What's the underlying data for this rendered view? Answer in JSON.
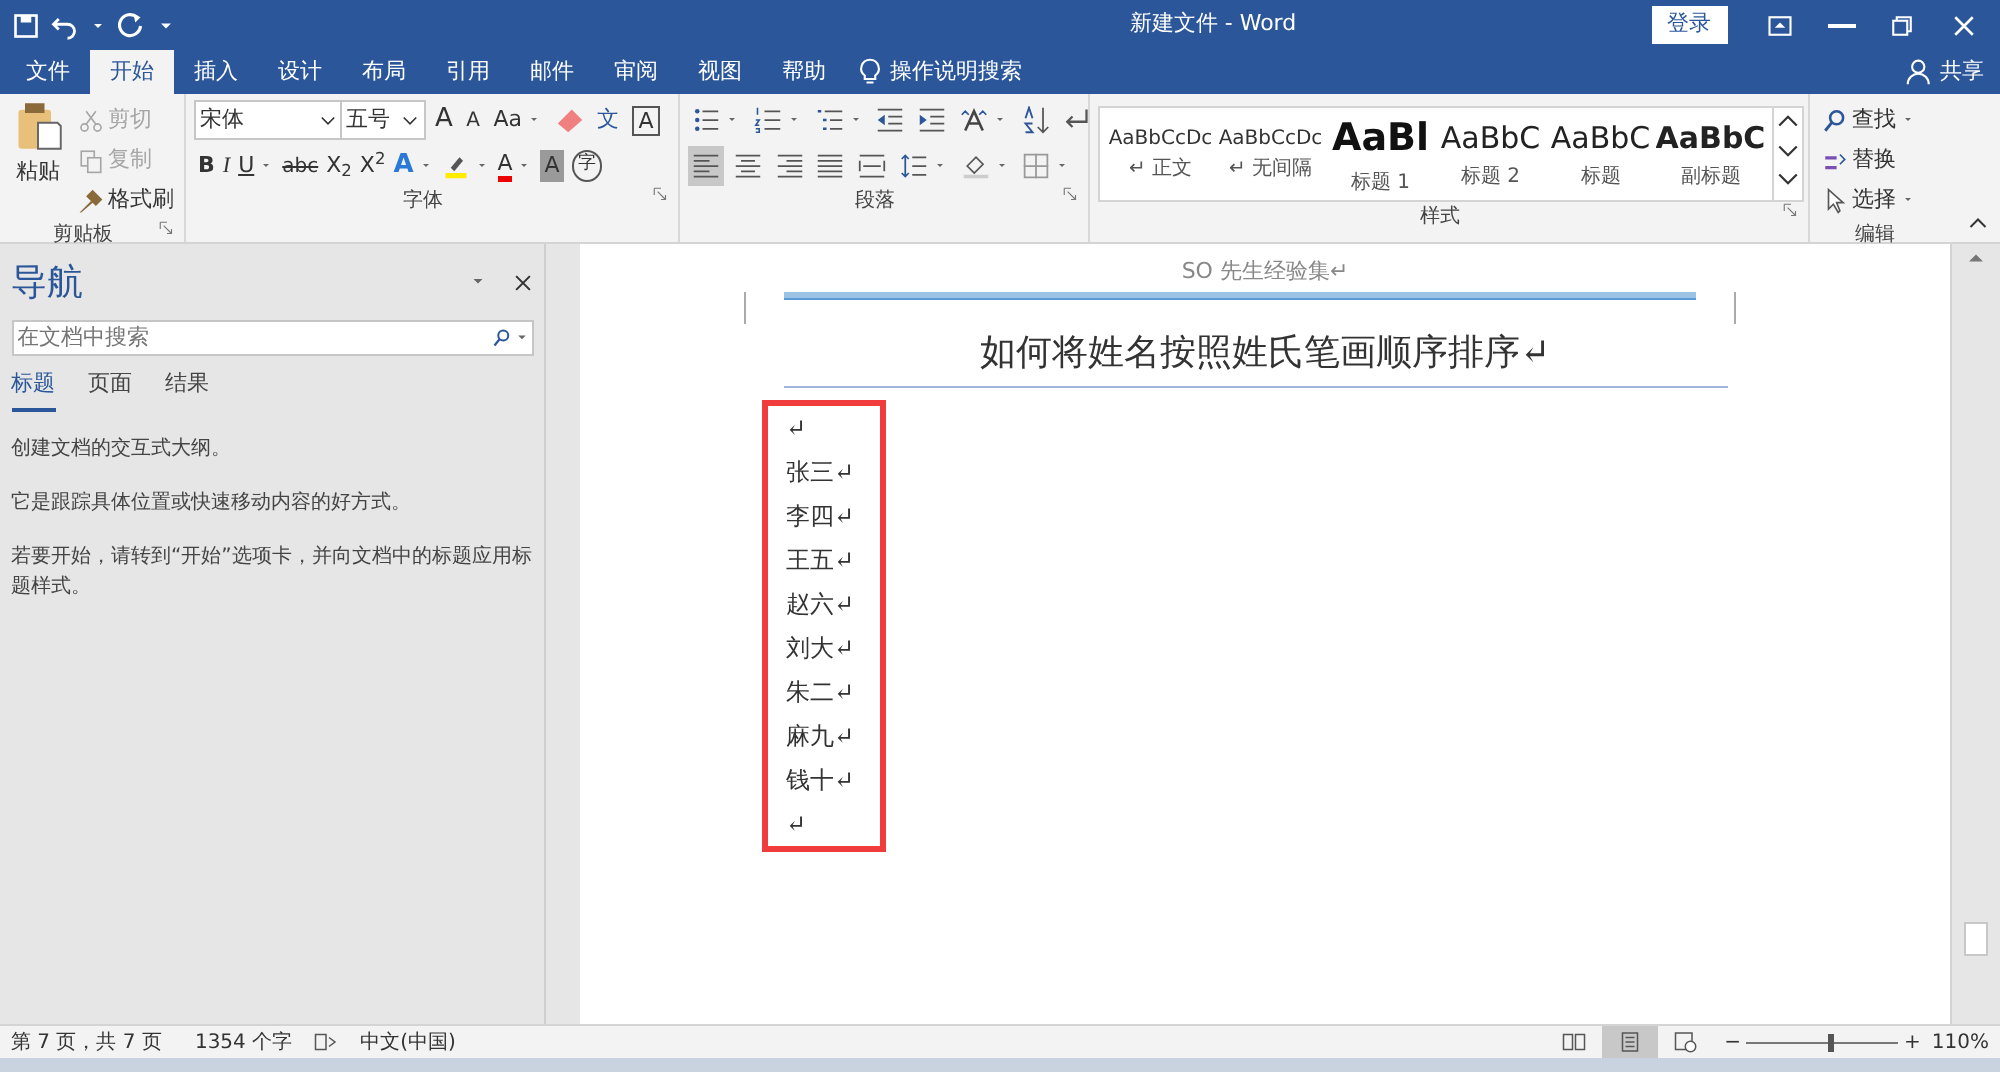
{
  "window": {
    "title": "新建文件 - Word",
    "login": "登录"
  },
  "tabs": [
    {
      "label": "文件",
      "selected": false
    },
    {
      "label": "开始",
      "selected": true
    },
    {
      "label": "插入",
      "selected": false
    },
    {
      "label": "设计",
      "selected": false
    },
    {
      "label": "布局",
      "selected": false
    },
    {
      "label": "引用",
      "selected": false
    },
    {
      "label": "邮件",
      "selected": false
    },
    {
      "label": "审阅",
      "selected": false
    },
    {
      "label": "视图",
      "selected": false
    },
    {
      "label": "帮助",
      "selected": false
    }
  ],
  "tell_me": "操作说明搜索",
  "share": "共享",
  "clipboard": {
    "paste": "粘贴",
    "cut": {
      "label": "剪切",
      "disabled": true
    },
    "copy": {
      "label": "复制",
      "disabled": true
    },
    "format_painter": {
      "label": "格式刷",
      "disabled": false
    },
    "label": "剪贴板"
  },
  "font": {
    "name": "宋体",
    "size": "五号",
    "grow": "A",
    "shrink": "A",
    "case": "Aa",
    "phonetic": "文",
    "char_border": "A",
    "bold": "B",
    "italic": "I",
    "underline": "U",
    "strike": "abc",
    "subscript": "X$_{2}$",
    "superscript": "X$^{2}$",
    "effects": "A",
    "font_color": "A",
    "char_shading": "A",
    "enclose": "字",
    "label": "字体"
  },
  "paragraph": {
    "alignments": [
      {
        "kind": "left",
        "selected": true
      },
      {
        "kind": "center",
        "selected": false
      },
      {
        "kind": "right",
        "selected": false
      },
      {
        "kind": "justify",
        "selected": false
      },
      {
        "kind": "distributed",
        "selected": false
      }
    ],
    "label": "段落"
  },
  "styles": {
    "items": [
      {
        "preview": "AaBbCcDc",
        "label": "↵ 正文",
        "kind": "normal"
      },
      {
        "preview": "AaBbCcDc",
        "label": "↵ 无间隔",
        "kind": "normal"
      },
      {
        "preview": "AaBl",
        "label": "标题 1",
        "kind": "heading1"
      },
      {
        "preview": "AaBbC",
        "label": "标题 2",
        "kind": "heading2"
      },
      {
        "preview": "AaBbC",
        "label": "标题",
        "kind": "title"
      },
      {
        "preview": "AaBbC",
        "label": "副标题",
        "kind": "subtitle"
      }
    ],
    "label": "样式"
  },
  "editing": {
    "find": "查找",
    "replace": "替换",
    "select": "选择",
    "label": "编辑"
  },
  "navigation": {
    "title": "导航",
    "search_placeholder": "在文档中搜索",
    "tabs": [
      {
        "label": "标题",
        "selected": true
      },
      {
        "label": "页面",
        "selected": false
      },
      {
        "label": "结果",
        "selected": false
      }
    ],
    "paragraphs": [
      "创建文档的交互式大纲。",
      "它是跟踪具体位置或快速移动内容的好方式。",
      "若要开始，请转到“开始”选项卡，并向文档中的标题应用标题样式。"
    ]
  },
  "document": {
    "header": "SO 先生经验集↵",
    "title": "如何将姓名按照姓氏笔画顺序排序↵",
    "lines": [
      "↵",
      "张三↵",
      "李四↵",
      "王五↵",
      "赵六↵",
      "刘大↵",
      "朱二↵",
      "麻九↵",
      "钱十↵",
      "↵"
    ]
  },
  "status_bar": {
    "page": "第 7 页，共 7 页",
    "words": "1354 个字",
    "language": "中文(中国)",
    "views": [
      {
        "kind": "read",
        "selected": false
      },
      {
        "kind": "print",
        "selected": true
      },
      {
        "kind": "web",
        "selected": false
      }
    ],
    "zoom_out": "−",
    "zoom": {
      "level": 0.53
    },
    "zoom_in": "+",
    "zoom_percent": "110%"
  }
}
